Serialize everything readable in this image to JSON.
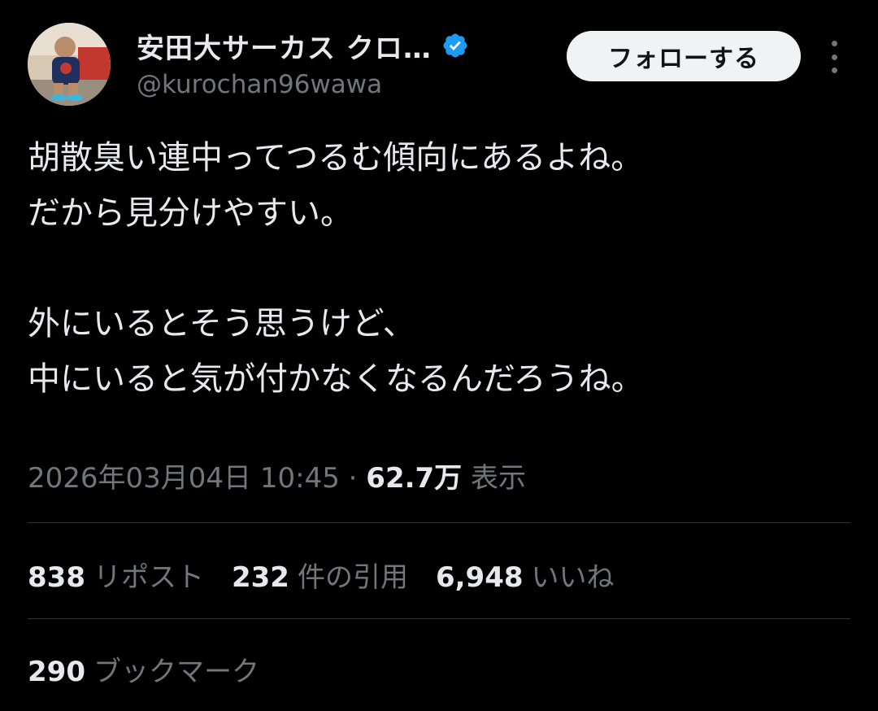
{
  "header": {
    "display_name": "安田大サーカス クロ…",
    "handle": "@kurochan96wawa",
    "follow_label": "フォローする",
    "verified_color": "#1d9bf0"
  },
  "tweet": {
    "lines": [
      "胡散臭い連中ってつるむ傾向にあるよね。",
      "だから見分けやすい。",
      "外にいるとそう思うけど、",
      "中にいると気が付かなくなるんだろうね。"
    ]
  },
  "meta": {
    "timestamp": "2026年03月04日 10:45",
    "separator": "·",
    "views_count": "62.7万",
    "views_label": "表示"
  },
  "stats": {
    "reposts_count": "838",
    "reposts_label": "リポスト",
    "quotes_count": "232",
    "quotes_label": "件の引用",
    "likes_count": "6,948",
    "likes_label": "いいね",
    "bookmarks_count": "290",
    "bookmarks_label": "ブックマーク"
  },
  "icons": {
    "avatar": "avatar",
    "verified": "verified-badge-icon",
    "more": "more-options-icon"
  }
}
